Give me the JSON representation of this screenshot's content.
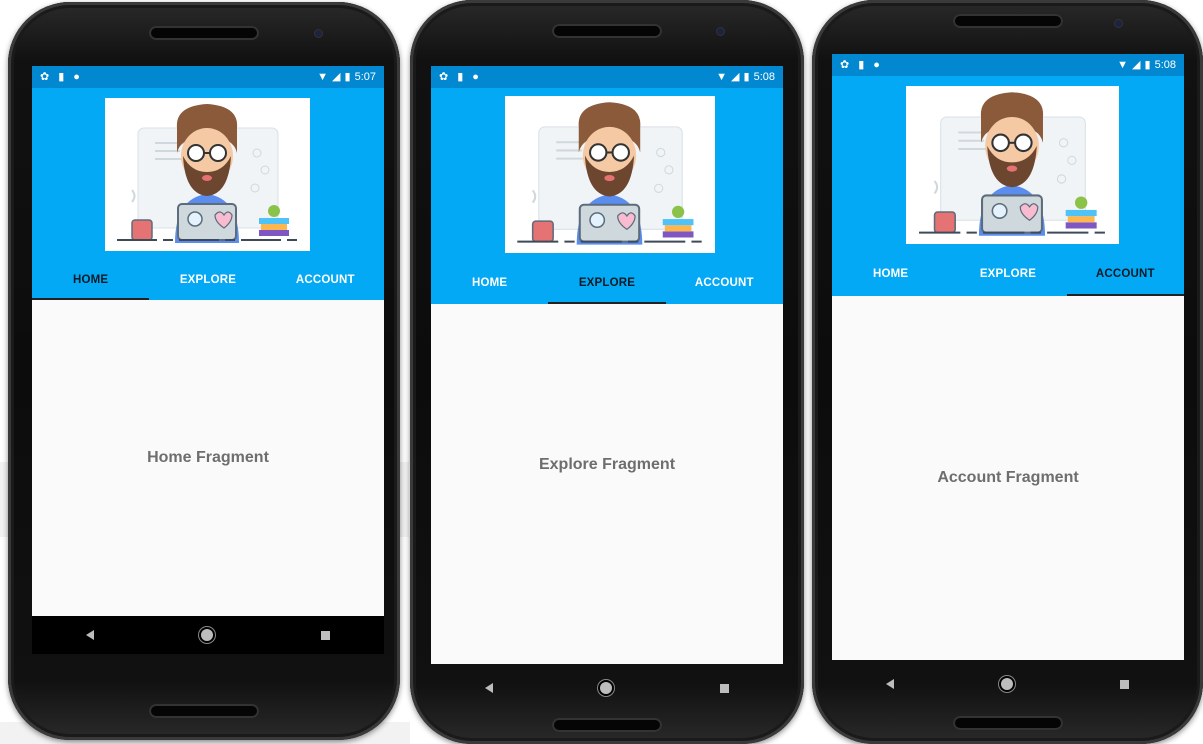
{
  "phones": [
    {
      "status_time": "5:07",
      "tabs": [
        {
          "label": "HOME",
          "active": true
        },
        {
          "label": "EXPLORE",
          "active": false
        },
        {
          "label": "ACCOUNT",
          "active": false
        }
      ],
      "content_text": "Home Fragment"
    },
    {
      "status_time": "5:08",
      "tabs": [
        {
          "label": "HOME",
          "active": false
        },
        {
          "label": "EXPLORE",
          "active": true
        },
        {
          "label": "ACCOUNT",
          "active": false
        }
      ],
      "content_text": "Explore Fragment"
    },
    {
      "status_time": "5:08",
      "tabs": [
        {
          "label": "HOME",
          "active": false
        },
        {
          "label": "EXPLORE",
          "active": false
        },
        {
          "label": "ACCOUNT",
          "active": true
        }
      ],
      "content_text": "Account Fragment"
    }
  ],
  "status_icons": [
    "settings-icon",
    "sd-card-icon",
    "sync-icon",
    "wifi-icon",
    "signal-icon",
    "battery-icon"
  ],
  "nav_icons": [
    "back-icon",
    "home-icon",
    "recents-icon"
  ],
  "colors": {
    "status_bar": "#0288d1",
    "app_bar": "#03a9f4",
    "active_tab_text": "#0a1a26",
    "tab_text": "#ffffff",
    "content_text": "#6e6e6e"
  }
}
